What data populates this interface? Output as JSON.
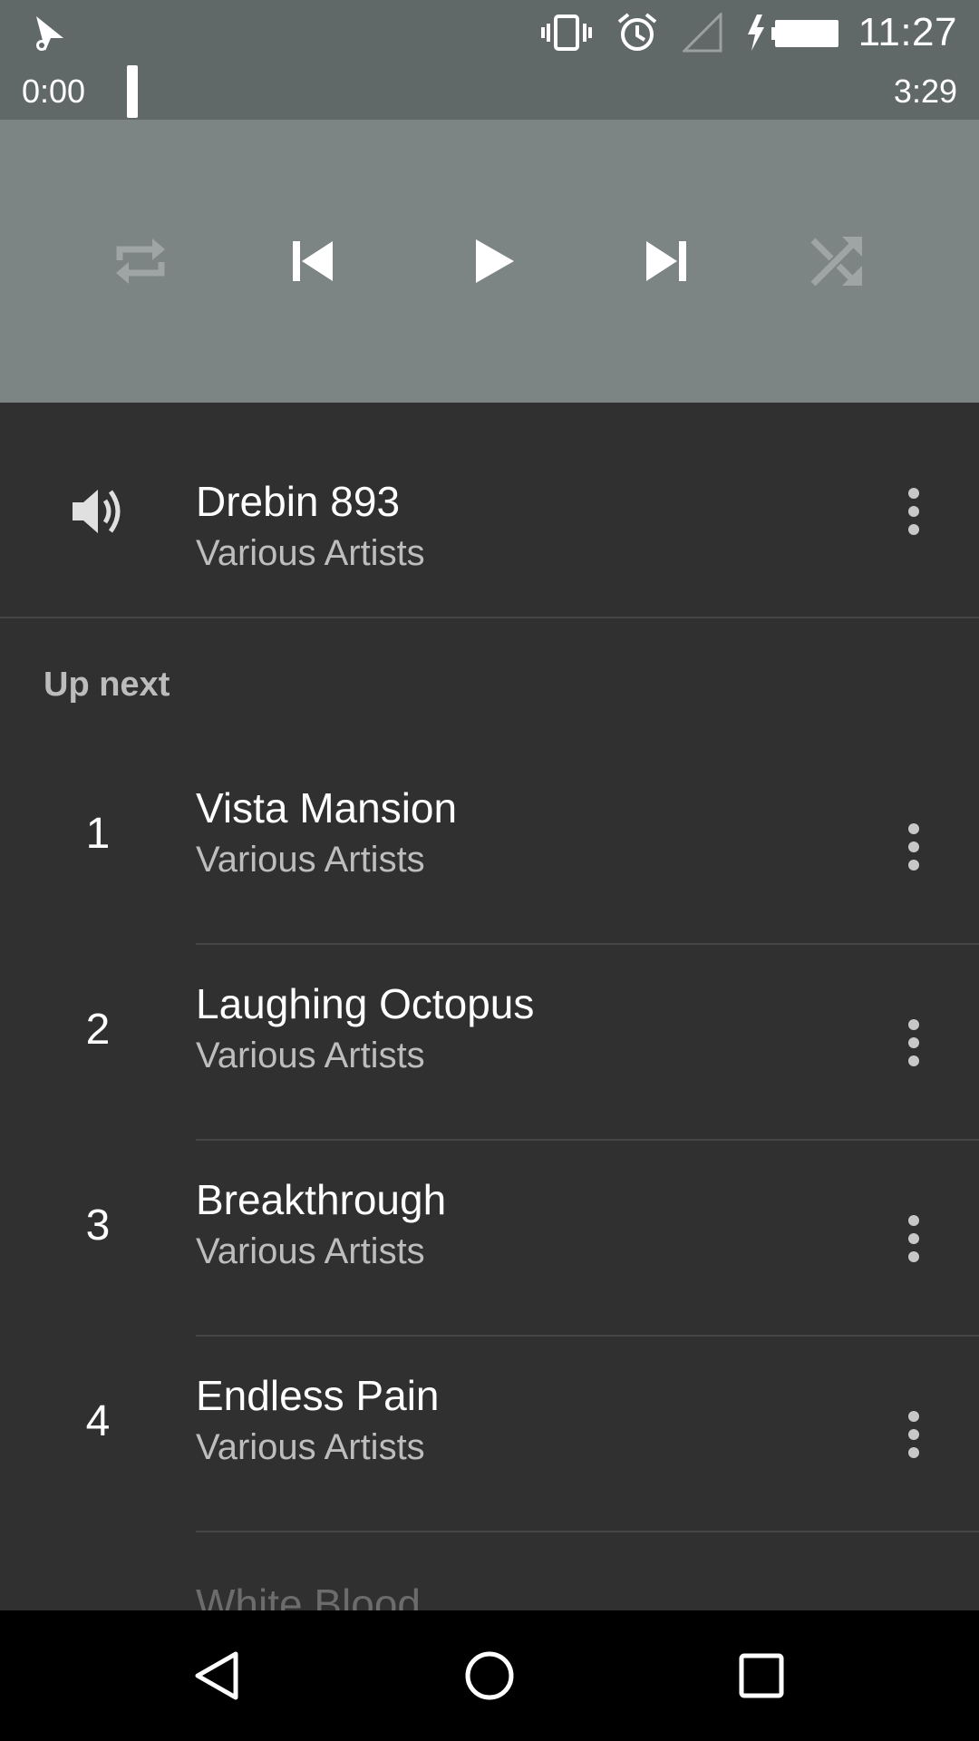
{
  "status_bar": {
    "clock": "11:27",
    "icons": [
      "music-notification-icon",
      "vibrate-icon",
      "alarm-icon",
      "no-signal-icon",
      "battery-charging-icon"
    ]
  },
  "player": {
    "elapsed": "0:00",
    "total": "3:29",
    "progress_fraction": 0.0,
    "controls": [
      "repeat",
      "previous",
      "play",
      "next",
      "shuffle"
    ]
  },
  "now_playing": {
    "title": "Drebin 893",
    "artist": "Various Artists"
  },
  "up_next_label": "Up next",
  "queue": [
    {
      "index": "1",
      "title": "Vista Mansion",
      "artist": "Various Artists"
    },
    {
      "index": "2",
      "title": "Laughing Octopus",
      "artist": "Various Artists"
    },
    {
      "index": "3",
      "title": "Breakthrough",
      "artist": "Various Artists"
    },
    {
      "index": "4",
      "title": "Endless Pain",
      "artist": "Various Artists"
    }
  ],
  "partial_item_title": "White Blood",
  "colors": {
    "status_bg": "#616868",
    "controls_bg": "#7c8584",
    "list_bg": "#303030",
    "nav_bg": "#000000"
  }
}
